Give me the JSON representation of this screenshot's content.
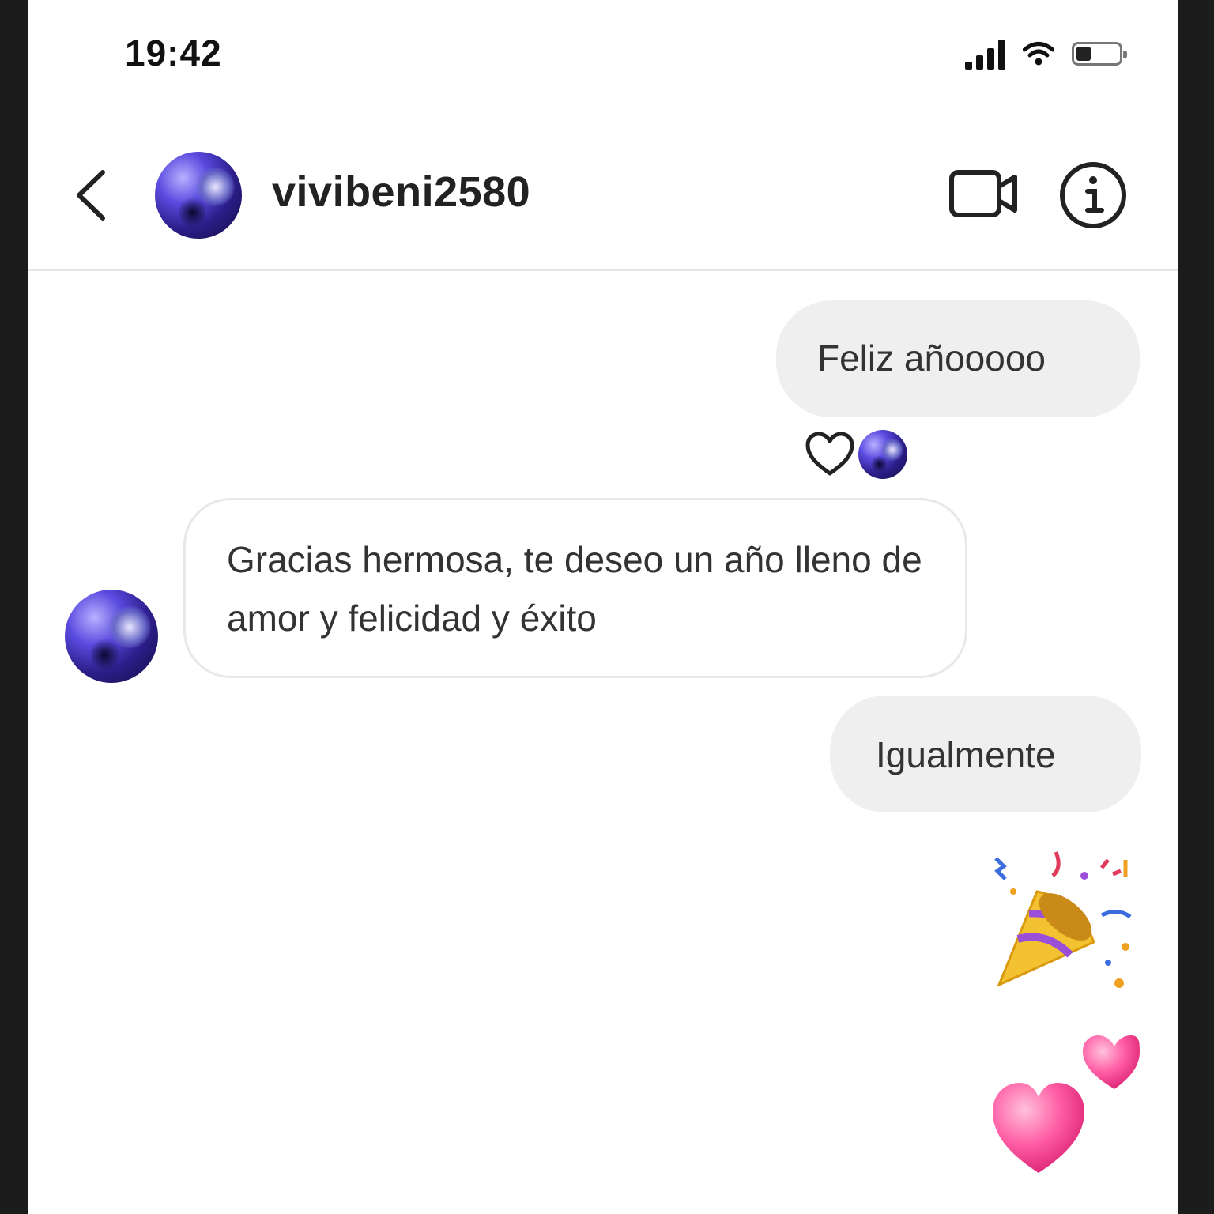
{
  "status_bar": {
    "time": "19:42",
    "icons": [
      "signal-icon",
      "wifi-icon",
      "battery-icon"
    ]
  },
  "header": {
    "username": "vivibeni2580",
    "icons": [
      "chevron-left-icon",
      "video-call-icon",
      "info-icon"
    ]
  },
  "messages": [
    {
      "side": "sent",
      "text": "Feliz añooooo",
      "reaction": "heart-icon"
    },
    {
      "side": "received",
      "text": "Gracias hermosa, te deseo un año lleno de amor y felicidad y éxito"
    },
    {
      "side": "sent",
      "text": "Igualmente"
    },
    {
      "side": "sent",
      "emoji": "🎉"
    },
    {
      "side": "sent",
      "emoji": "💕"
    }
  ],
  "colors": {
    "sent_bubble": "#efefef",
    "received_border": "#e8e8e8",
    "heart_emoji": "#ff4f9a"
  }
}
